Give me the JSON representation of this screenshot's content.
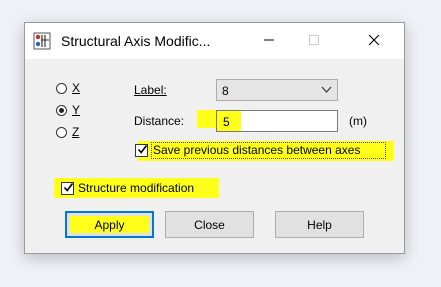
{
  "window": {
    "title": "Structural Axis Modific...",
    "icon": "app-icon",
    "controls": {
      "minimize_icon": "minimize-icon",
      "maximize_icon": "maximize-icon",
      "close_icon": "close-icon"
    }
  },
  "axis_options": [
    {
      "label": "X",
      "checked": false
    },
    {
      "label": "Y",
      "checked": true
    },
    {
      "label": "Z",
      "checked": false
    }
  ],
  "label_field": {
    "caption": "Label:",
    "value": "8"
  },
  "distance_field": {
    "caption": "Distance:",
    "value": "5",
    "unit": "(m)"
  },
  "save_distances": {
    "label": "Save previous distances between axes",
    "checked": true
  },
  "structure_modification": {
    "label": "Structure modification",
    "checked": true
  },
  "buttons": {
    "apply": "Apply",
    "close": "Close",
    "help": "Help"
  },
  "colors": {
    "highlight": "#ffff1a",
    "default_button_border": "#0078d7"
  }
}
